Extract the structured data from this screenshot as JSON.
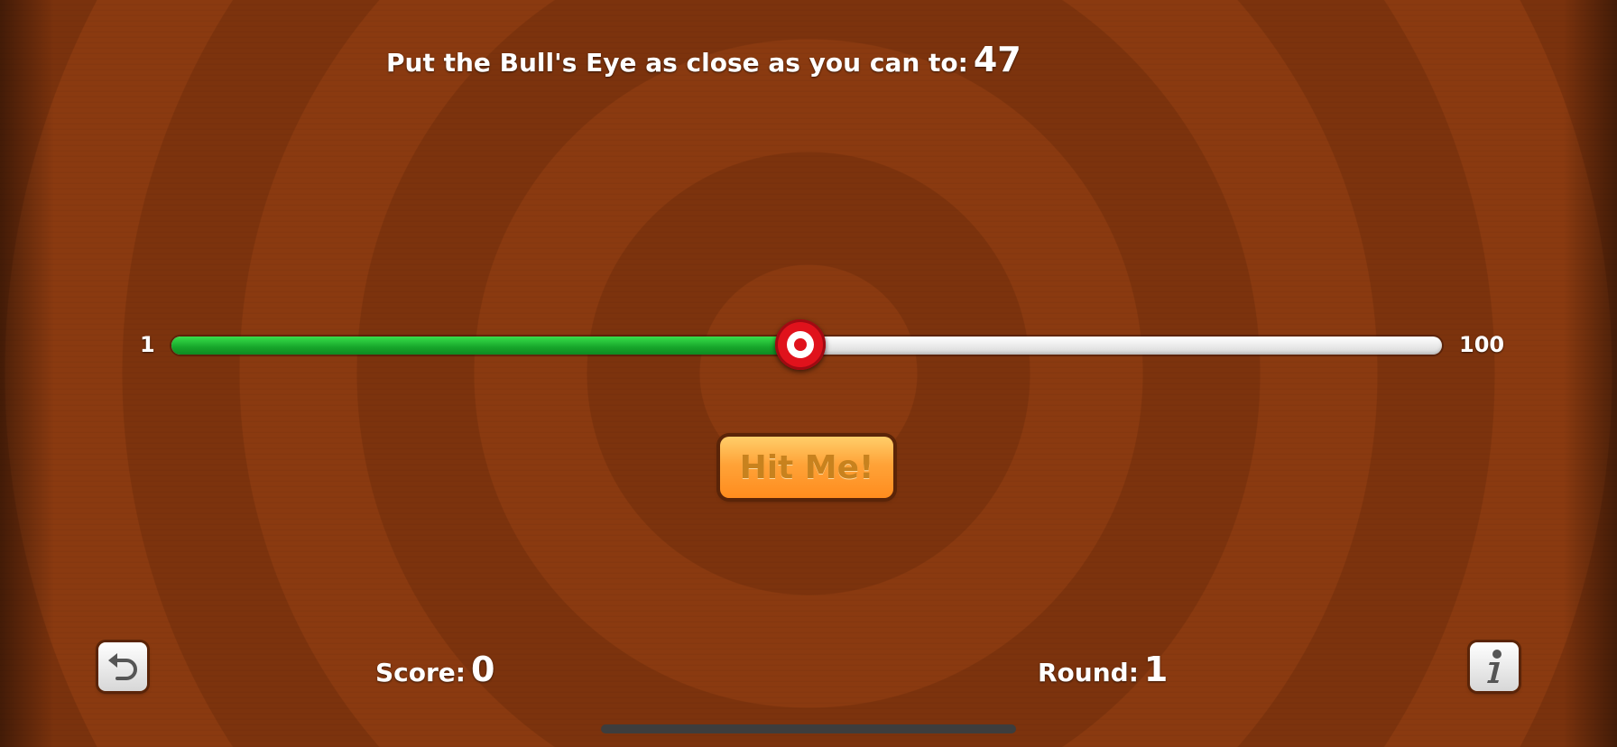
{
  "game": {
    "prompt": "Put the Bull's Eye as close as you can to:",
    "target_value": "47",
    "slider": {
      "min_label": "1",
      "max_label": "100",
      "min": 1,
      "max": 100,
      "value": 50
    },
    "hit_button_label": "Hit Me!",
    "score_label": "Score:",
    "score_value": "0",
    "round_label": "Round:",
    "round_value": "1"
  },
  "icons": {
    "start_over": "undo-arrow-icon",
    "info": "info-icon"
  },
  "colors": {
    "background": "#7a3410",
    "slider_fill": "#16a52a",
    "slider_track": "#ffffff",
    "thumb": "#e0121c",
    "button": "#ffa338",
    "button_text": "#c8821e"
  }
}
